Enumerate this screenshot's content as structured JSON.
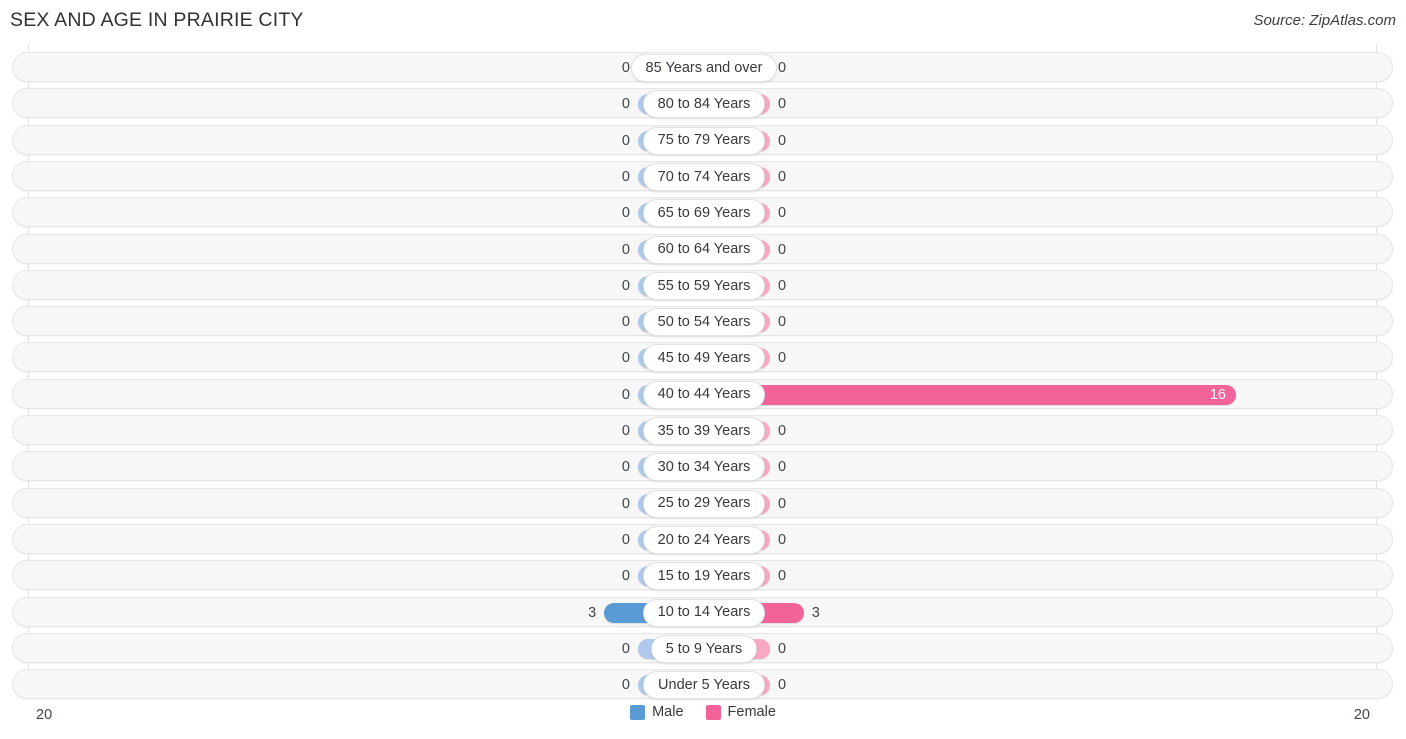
{
  "header": {
    "title": "SEX AND AGE IN PRAIRIE CITY",
    "source": "Source: ZipAtlas.com"
  },
  "legend": {
    "male_label": "Male",
    "female_label": "Female",
    "male_color": "#5b9bd5",
    "female_color": "#f2639a",
    "male_muted_color": "#aec9eb",
    "female_muted_color": "#f9a8c3"
  },
  "axis": {
    "left_tick": "20",
    "right_tick": "20",
    "max": 20
  },
  "chart_data": {
    "type": "bar",
    "title": "SEX AND AGE IN PRAIRIE CITY",
    "subtitle": "",
    "xlabel": "",
    "ylabel": "",
    "orientation": "horizontal",
    "layout": "population-pyramid",
    "grid": false,
    "legend_position": "bottom-center",
    "xlim": [
      20,
      20
    ],
    "categories": [
      "85 Years and over",
      "80 to 84 Years",
      "75 to 79 Years",
      "70 to 74 Years",
      "65 to 69 Years",
      "60 to 64 Years",
      "55 to 59 Years",
      "50 to 54 Years",
      "45 to 49 Years",
      "40 to 44 Years",
      "35 to 39 Years",
      "30 to 34 Years",
      "25 to 29 Years",
      "20 to 24 Years",
      "15 to 19 Years",
      "10 to 14 Years",
      "5 to 9 Years",
      "Under 5 Years"
    ],
    "series": [
      {
        "name": "Male",
        "values": [
          0,
          0,
          0,
          0,
          0,
          0,
          0,
          0,
          0,
          0,
          0,
          0,
          0,
          0,
          0,
          3,
          0,
          0
        ]
      },
      {
        "name": "Female",
        "values": [
          0,
          0,
          0,
          0,
          0,
          0,
          0,
          0,
          0,
          16,
          0,
          0,
          0,
          0,
          0,
          3,
          0,
          0
        ]
      }
    ]
  },
  "rows": [
    {
      "age": "85 Years and over",
      "male": "0",
      "female": "0"
    },
    {
      "age": "80 to 84 Years",
      "male": "0",
      "female": "0"
    },
    {
      "age": "75 to 79 Years",
      "male": "0",
      "female": "0"
    },
    {
      "age": "70 to 74 Years",
      "male": "0",
      "female": "0"
    },
    {
      "age": "65 to 69 Years",
      "male": "0",
      "female": "0"
    },
    {
      "age": "60 to 64 Years",
      "male": "0",
      "female": "0"
    },
    {
      "age": "55 to 59 Years",
      "male": "0",
      "female": "0"
    },
    {
      "age": "50 to 54 Years",
      "male": "0",
      "female": "0"
    },
    {
      "age": "45 to 49 Years",
      "male": "0",
      "female": "0"
    },
    {
      "age": "40 to 44 Years",
      "male": "0",
      "female": "16"
    },
    {
      "age": "35 to 39 Years",
      "male": "0",
      "female": "0"
    },
    {
      "age": "30 to 34 Years",
      "male": "0",
      "female": "0"
    },
    {
      "age": "25 to 29 Years",
      "male": "0",
      "female": "0"
    },
    {
      "age": "20 to 24 Years",
      "male": "0",
      "female": "0"
    },
    {
      "age": "15 to 19 Years",
      "male": "0",
      "female": "0"
    },
    {
      "age": "10 to 14 Years",
      "male": "3",
      "female": "3"
    },
    {
      "age": "5 to 9 Years",
      "male": "0",
      "female": "0"
    },
    {
      "age": "Under 5 Years",
      "male": "0",
      "female": "0"
    }
  ]
}
